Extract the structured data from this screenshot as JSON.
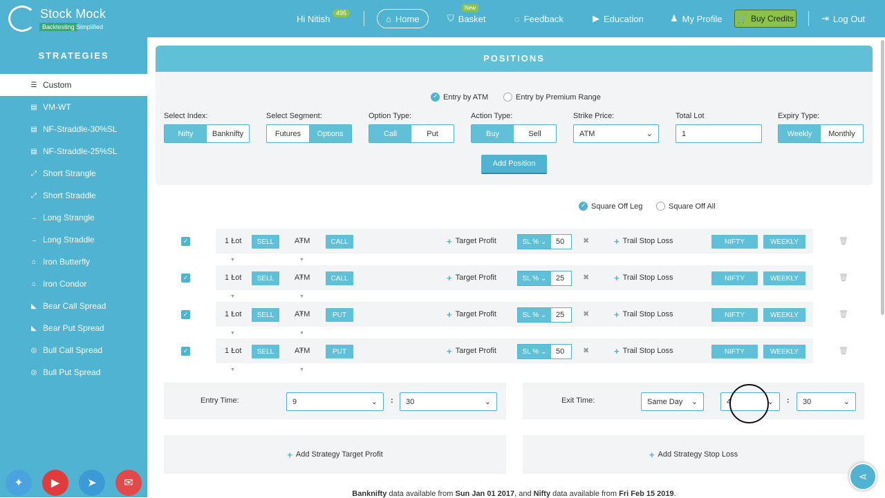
{
  "brand": {
    "name": "Stock Mock",
    "tag_a": "Backtesting",
    "tag_b": "Simplified"
  },
  "header": {
    "greeting": "Hi Nitish",
    "credits_badge": "495",
    "home": "Home",
    "basket": "Basket",
    "basket_badge": "New",
    "feedback": "Feedback",
    "education": "Education",
    "profile": "My Profile",
    "buy_credits": "Buy Credits",
    "logout": "Log Out"
  },
  "sidebar": {
    "title": "STRATEGIES",
    "items": [
      {
        "label": "Custom",
        "icon": "sliders-icon",
        "glyph": "☰",
        "active": true
      },
      {
        "label": "VM-WT",
        "icon": "file-icon",
        "glyph": "▤"
      },
      {
        "label": "NF-Straddle-30%SL",
        "icon": "file-icon",
        "glyph": "▤"
      },
      {
        "label": "NF-Straddle-25%SL",
        "icon": "file-icon",
        "glyph": "▤"
      },
      {
        "label": "Short Strangle",
        "icon": "expand-icon",
        "glyph": "⤢"
      },
      {
        "label": "Short Straddle",
        "icon": "expand-icon",
        "glyph": "⤢"
      },
      {
        "label": "Long Strangle",
        "icon": "arrow-right-icon",
        "glyph": "→"
      },
      {
        "label": "Long Straddle",
        "icon": "arrow-right-icon",
        "glyph": "→"
      },
      {
        "label": "Iron Butterfly",
        "icon": "gift-icon",
        "glyph": "⌂"
      },
      {
        "label": "Iron Condor",
        "icon": "gift-icon",
        "glyph": "⌂"
      },
      {
        "label": "Bear Call Spread",
        "icon": "bookmark-icon",
        "glyph": "◣"
      },
      {
        "label": "Bear Put Spread",
        "icon": "bookmark-icon",
        "glyph": "◣"
      },
      {
        "label": "Bull Call Spread",
        "icon": "target-icon",
        "glyph": "◎"
      },
      {
        "label": "Bull Put Spread",
        "icon": "target-icon",
        "glyph": "◎"
      }
    ]
  },
  "positions": {
    "title": "POSITIONS",
    "entry_by_atm": "Entry by ATM",
    "entry_by_premium": "Entry by Premium Range",
    "select_index_label": "Select Index:",
    "index_options": [
      "Nifty",
      "Banknifty"
    ],
    "select_segment_label": "Select Segment:",
    "segment_options": [
      "Futures",
      "Options"
    ],
    "option_type_label": "Option Type:",
    "option_types": [
      "Call",
      "Put"
    ],
    "action_type_label": "Action Type:",
    "action_types": [
      "Buy",
      "Sell"
    ],
    "strike_price_label": "Strike Price:",
    "strike_price_value": "ATM",
    "total_lot_label": "Total Lot",
    "total_lot_value": "1",
    "expiry_type_label": "Expiry Type:",
    "expiry_types": [
      "Weekly",
      "Monthly"
    ],
    "add_position": "Add Position"
  },
  "square_off": {
    "leg": "Square Off Leg",
    "all": "Square Off All"
  },
  "legs": [
    {
      "lot": "1 Lot",
      "action": "SELL",
      "strike": "ATM",
      "type": "CALL",
      "target": "Target Profit",
      "sl": "SL %",
      "sl_value": "50",
      "trail": "Trail Stop Loss",
      "index": "NIFTY",
      "expiry": "WEEKLY"
    },
    {
      "lot": "1 Lot",
      "action": "SELL",
      "strike": "ATM",
      "type": "CALL",
      "target": "Target Profit",
      "sl": "SL %",
      "sl_value": "25",
      "trail": "Trail Stop Loss",
      "index": "NIFTY",
      "expiry": "WEEKLY"
    },
    {
      "lot": "1 Lot",
      "action": "SELL",
      "strike": "ATM",
      "type": "PUT",
      "target": "Target Profit",
      "sl": "SL %",
      "sl_value": "25",
      "trail": "Trail Stop Loss",
      "index": "NIFTY",
      "expiry": "WEEKLY"
    },
    {
      "lot": "1 Lot",
      "action": "SELL",
      "strike": "ATM",
      "type": "PUT",
      "target": "Target Profit",
      "sl": "SL %",
      "sl_value": "50",
      "trail": "Trail Stop Loss",
      "index": "NIFTY",
      "expiry": "WEEKLY"
    }
  ],
  "entry_time": {
    "label": "Entry Time:",
    "hour": "9",
    "minute": "30"
  },
  "exit_time": {
    "label": "Exit Time:",
    "day": "Same Day",
    "hour": "4",
    "minute": "30"
  },
  "strategy": {
    "target": "Add Strategy Target Profit",
    "stop_loss": "Add Strategy Stop Loss"
  },
  "footnote": {
    "a": "Banknifty",
    "b": " data available from ",
    "c": "Sun Jan 01 2017",
    "d": ", and ",
    "e": "Nifty",
    "f": " data available from ",
    "g": "Fri Feb 15 2019",
    "h": "."
  },
  "colors": {
    "accent": "#4fb3d1",
    "credits": "#8bc34a",
    "twitter": "#4aa3df",
    "youtube": "#e23b3b",
    "telegram": "#3d9ad6",
    "mail": "#e24a4a"
  }
}
